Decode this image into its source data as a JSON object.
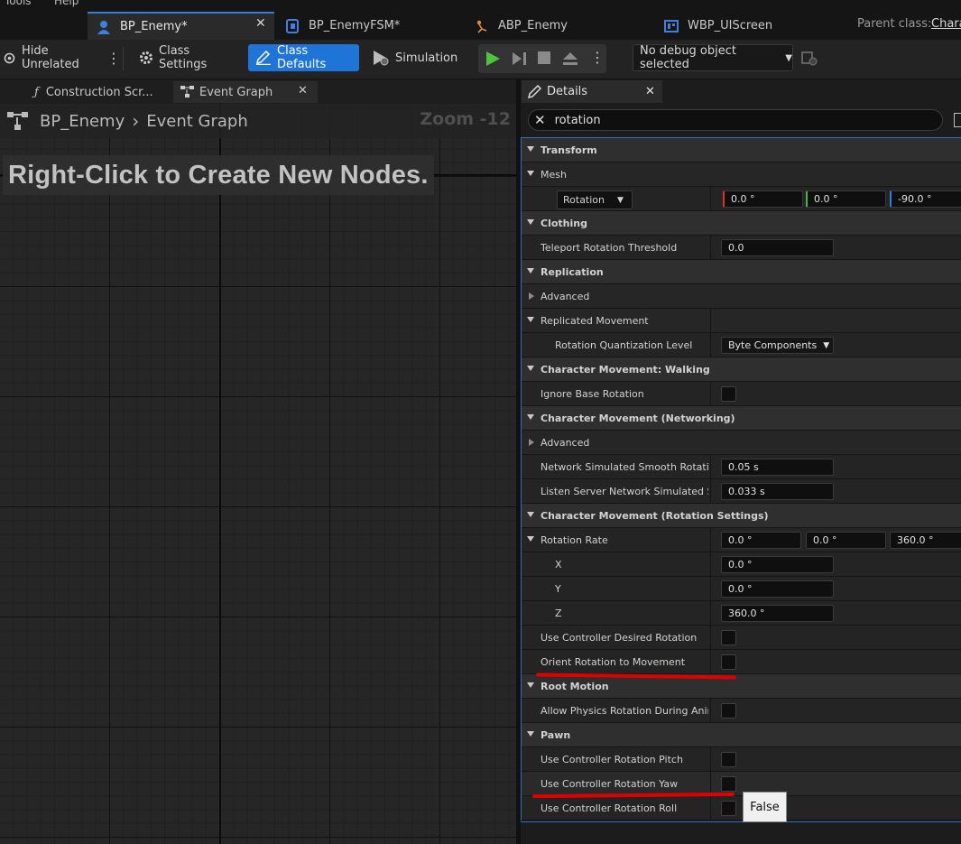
{
  "menu": {
    "items": [
      "Tools",
      "Help"
    ]
  },
  "tabs": [
    {
      "label": "BP_Enemy*",
      "icon": "blueprint-actor-icon"
    },
    {
      "label": "BP_EnemyFSM*",
      "icon": "blueprint-class-icon"
    },
    {
      "label": "ABP_Enemy",
      "icon": "anim-blueprint-icon"
    },
    {
      "label": "WBP_UIScreen",
      "icon": "widget-blueprint-icon"
    }
  ],
  "parent_class": {
    "label": "Parent class:",
    "value": "Chara"
  },
  "toolbar": {
    "hide_unrelated": "Hide Unrelated",
    "class_settings": "Class Settings",
    "class_defaults": "Class Defaults",
    "simulation": "Simulation",
    "debug_object": "No debug object selected"
  },
  "graph_tabs": [
    {
      "label": "Construction Scr...",
      "icon": "function-icon"
    },
    {
      "label": "Event Graph",
      "icon": "graph-icon"
    }
  ],
  "graph": {
    "breadcrumb_root": "BP_Enemy",
    "breadcrumb_leaf": "Event Graph",
    "zoom": "Zoom -12",
    "hint": "Right-Click to Create New Nodes."
  },
  "details": {
    "title": "Details",
    "search_value": "rotation",
    "rows": {
      "transform": "Transform",
      "mesh": "Mesh",
      "rotation_dropdown": "Rotation",
      "rot_x": "0.0 °",
      "rot_y": "0.0 °",
      "rot_z": "-90.0 °",
      "clothing": "Clothing",
      "teleport_label": "Teleport Rotation Threshold",
      "teleport_value": "0.0",
      "replication": "Replication",
      "advanced_1": "Advanced",
      "replicated_movement": "Replicated Movement",
      "rq_label": "Rotation Quantization Level",
      "rq_value": "Byte Components",
      "cm_walking": "Character Movement: Walking",
      "ignore_base": "Ignore Base Rotation",
      "cm_networking": "Character Movement (Networking)",
      "advanced_2": "Advanced",
      "net_smooth_label": "Network Simulated Smooth Rotatio...",
      "net_smooth_value": "0.05 s",
      "listen_label": "Listen Server Network Simulated S...",
      "listen_value": "0.033 s",
      "cm_rotation": "Character Movement (Rotation Settings)",
      "rotation_rate": "Rotation Rate",
      "rr_x": "0.0 °",
      "rr_y": "0.0 °",
      "rr_z": "360.0 °",
      "x_label": "X",
      "x_value": "0.0 °",
      "y_label": "Y",
      "y_value": "0.0 °",
      "z_label": "Z",
      "z_value": "360.0 °",
      "use_desired": "Use Controller Desired Rotation",
      "orient": "Orient Rotation to Movement",
      "root_motion": "Root Motion",
      "allow_physics": "Allow Physics Rotation During Anim...",
      "pawn": "Pawn",
      "pitch": "Use Controller Rotation Pitch",
      "yaw": "Use Controller Rotation Yaw",
      "roll": "Use Controller Rotation Roll"
    },
    "tooltip": "False"
  },
  "colors": {
    "accent": "#1f74d8",
    "annotation": "#e10000",
    "play": "#4cc43c"
  }
}
